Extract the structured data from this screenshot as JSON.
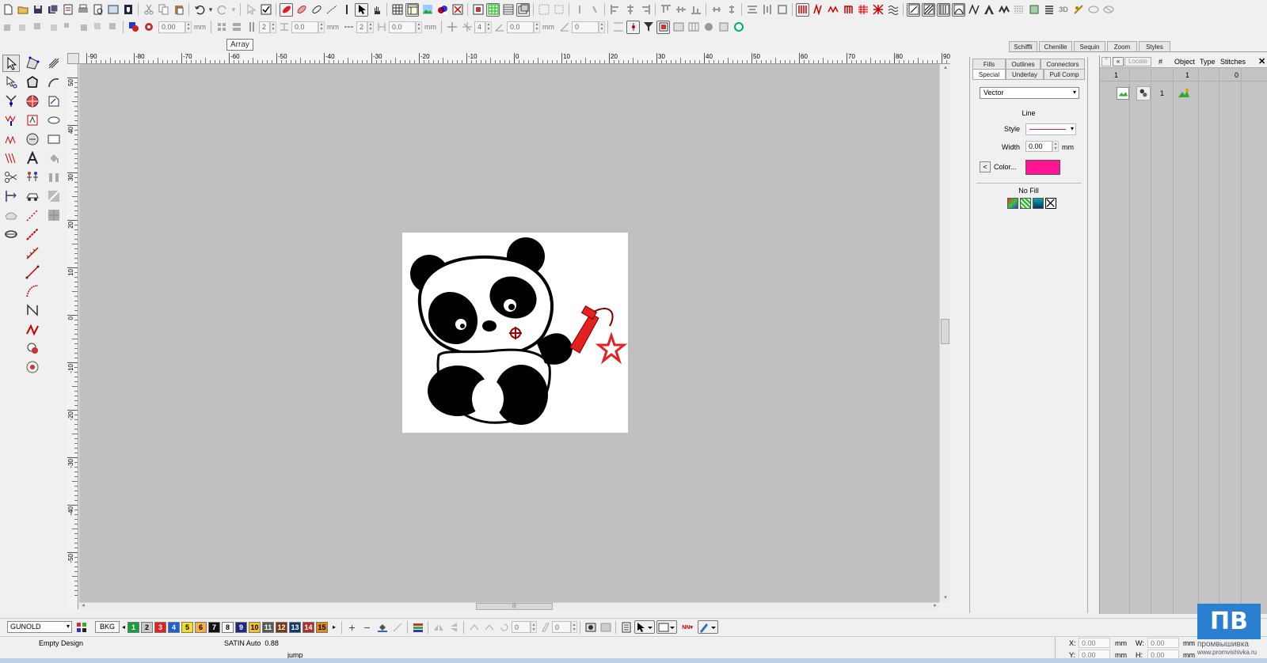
{
  "toolbar2": {
    "stitch_value": "0.00",
    "stitch_unit": "mm",
    "array_count": "2",
    "array_dx": "0.0",
    "array_unit": "mm",
    "array_count2": "2",
    "array_dy": "0.0",
    "array_unit2": "mm",
    "rotate_count": "4",
    "rotate_value": "0.0",
    "rotate_unit": "mm",
    "angle_value": "0",
    "tooltip": "Array"
  },
  "right_tabs": [
    "Schiffli",
    "Chenille",
    "Sequin",
    "Zoom",
    "Styles"
  ],
  "props": {
    "tabs_row1": [
      "Fills",
      "Outlines",
      "Connectors"
    ],
    "tabs_row2": [
      "Special",
      "Underlay",
      "Pull Comp"
    ],
    "type_select": "Vector",
    "section_line": "Line",
    "style_label": "Style",
    "width_label": "Width",
    "width_value": "0.00",
    "width_unit": "mm",
    "color_label": "Color...",
    "color_value": "#ff1493",
    "nofill_label": "No Fill"
  },
  "objects": {
    "locate_label": "Locate",
    "headers": [
      "#",
      "Object",
      "Type",
      "Stitches"
    ],
    "header_values": [
      "1",
      "1",
      "0"
    ],
    "row_number": "1"
  },
  "ruler_h": [
    "-90",
    "-80",
    "-70",
    "-60",
    "-50",
    "-40",
    "-30",
    "-20",
    "-10",
    "0",
    "10",
    "20",
    "30",
    "40",
    "50",
    "60",
    "70",
    "80",
    "90"
  ],
  "ruler_v": [
    "50",
    "40",
    "30",
    "20",
    "10",
    "0",
    "-10",
    "-20",
    "-30",
    "-40",
    "-50"
  ],
  "colorbar": {
    "thread_select": "GUNOLD",
    "bkg_label": "BKG",
    "swatches": [
      {
        "n": "1",
        "c": "#1a9e3a",
        "fg": "#fff"
      },
      {
        "n": "2",
        "c": "#c8c8c8",
        "fg": "#000"
      },
      {
        "n": "3",
        "c": "#e52020",
        "fg": "#fff"
      },
      {
        "n": "4",
        "c": "#2060d0",
        "fg": "#fff"
      },
      {
        "n": "5",
        "c": "#f2e020",
        "fg": "#000"
      },
      {
        "n": "6",
        "c": "#f5b040",
        "fg": "#000"
      },
      {
        "n": "7",
        "c": "#111111",
        "fg": "#fff"
      },
      {
        "n": "8",
        "c": "#ffffff",
        "fg": "#000"
      },
      {
        "n": "9",
        "c": "#1c2a80",
        "fg": "#fff"
      },
      {
        "n": "10",
        "c": "#f5c030",
        "fg": "#000"
      },
      {
        "n": "11",
        "c": "#5a5a5a",
        "fg": "#fff"
      },
      {
        "n": "12",
        "c": "#7a3a10",
        "fg": "#fff"
      },
      {
        "n": "13",
        "c": "#103a70",
        "fg": "#fff"
      },
      {
        "n": "14",
        "c": "#b0302a",
        "fg": "#fff"
      },
      {
        "n": "15",
        "c": "#e08a10",
        "fg": "#000"
      }
    ],
    "field1": "0",
    "field2": "0"
  },
  "status": {
    "design": "Empty Design",
    "mode": "SATIN Auto  0.88",
    "jump": "jump",
    "x_label": "X:",
    "x_value": "0.00",
    "y_label": "Y:",
    "y_value": "0.00",
    "w_label": "W:",
    "w_value": "0.00",
    "h_label": "H:",
    "h_value": "0.00",
    "unit": "mm"
  },
  "watermark": {
    "logo": "ПВ",
    "text1": "промвышивка",
    "text2": "www.promvishivka.ru"
  }
}
